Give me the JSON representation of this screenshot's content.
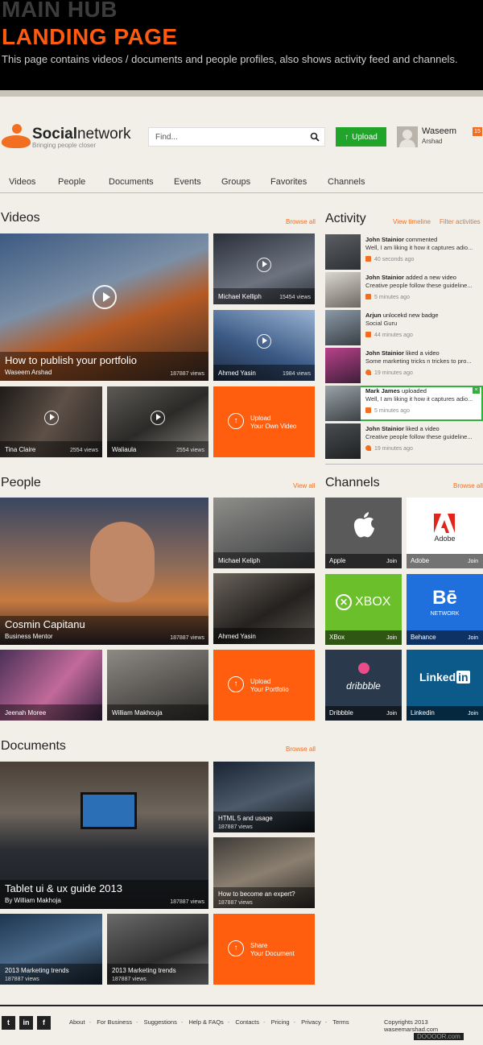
{
  "banner": {
    "title1": "MAIN HUB",
    "title2": "LANDING PAGE",
    "description": "This page contains videos / documents and people profiles, also shows activity feed and channels."
  },
  "header": {
    "brand_bold": "Social",
    "brand_rest": "network",
    "tagline": "Bringing people closer",
    "search_placeholder": "Find...",
    "upload_label": "Upload",
    "user_first": "Waseem",
    "user_last": "Arshad",
    "notification_count": "15"
  },
  "nav": [
    "Videos",
    "People",
    "Documents",
    "Events",
    "Groups",
    "Favorites",
    "Channels"
  ],
  "videos": {
    "title": "Videos",
    "link": "Browse all",
    "featured": {
      "title": "How to publish your portfolio",
      "author": "Waseem Arshad",
      "views": "187887 views"
    },
    "side": [
      {
        "name": "Michael Kelliph",
        "views": "15454 views"
      },
      {
        "name": "Ahmed Yasin",
        "views": "1984 views"
      }
    ],
    "bottom": [
      {
        "name": "Tina Claire",
        "views": "2554 views"
      },
      {
        "name": "Waliaula",
        "views": "2554 views"
      }
    ],
    "cta1": "Upload",
    "cta2": "Your Own Video"
  },
  "activity": {
    "title": "Activity",
    "link1": "View timeline",
    "link2": "Filter activities",
    "items": [
      {
        "name": "John Stainior",
        "action": "commented",
        "text": "Well, I am liking it how it captures adio...",
        "time": "40 seconds ago"
      },
      {
        "name": "John Stainior",
        "action": "added a new video",
        "text": "Creative people follow these guideline...",
        "time": "5 minutes ago"
      },
      {
        "name": "Arjun",
        "action": "unlocekd new badge",
        "text": "Social Guru",
        "time": "44 minutes ago"
      },
      {
        "name": "John Stainior",
        "action": "liked a video",
        "text": "Some marketing tricks n trickes to pro...",
        "time": "19 minutes ago"
      },
      {
        "name": "Mark James",
        "action": "uploaded",
        "text": "Well, I am liking it how it captures adio...",
        "time": "5 minutes ago"
      },
      {
        "name": "John Stainior",
        "action": "liked a video",
        "text": "Creative people follow these guideline...",
        "time": "19 minutes ago"
      }
    ]
  },
  "people": {
    "title": "People",
    "link": "View all",
    "featured": {
      "name": "Cosmin Capitanu",
      "role": "Business Mentor",
      "views": "187887 views"
    },
    "side": [
      "Michael Keliph",
      "Ahmed Yasin"
    ],
    "bottom": [
      "Jeenah Moree",
      "William Makhouja"
    ],
    "cta1": "Upload",
    "cta2": "Your Portfolio"
  },
  "channels": {
    "title": "Channels",
    "link": "Browse all",
    "join": "Join",
    "items": [
      {
        "name": "Apple",
        "color": "#5a5a5a",
        "logo": ""
      },
      {
        "name": "Adobe",
        "color": "#ffffff",
        "logo": "Adobe"
      },
      {
        "name": "XBox",
        "color": "#6bbf2a",
        "logo": "XBOX"
      },
      {
        "name": "Behance",
        "color": "#1f6fdc",
        "logo": "Bē",
        "logo_sub": "NETWORK"
      },
      {
        "name": "Dribbble",
        "color": "#2a3a4c",
        "logo": "dribbble"
      },
      {
        "name": "Linkedin",
        "color": "#0c5a8a",
        "logo": "Linked",
        "logo_box": "in"
      }
    ]
  },
  "documents": {
    "title": "Documents",
    "link": "Browse all",
    "featured": {
      "title": "Tablet ui & ux guide 2013",
      "author": "By William Makhoja",
      "views": "187887 views"
    },
    "side": [
      {
        "title": "HTML 5 and usage",
        "views": "187887 views"
      },
      {
        "title": "How to become an expert?",
        "views": "187887 views"
      }
    ],
    "bottom": [
      {
        "title": "2013 Marketing trends",
        "views": "187887 views"
      },
      {
        "title": "2013 Marketing trends",
        "views": "187887 views"
      }
    ],
    "cta1": "Share",
    "cta2": "Your Document"
  },
  "footer": {
    "links": [
      "About",
      "For Business",
      "Suggestions",
      "Help & FAQs",
      "Contacts",
      "Pricing",
      "Privacy",
      "Terms"
    ],
    "copyright": "Copyrights 2013 waseemarshad.com",
    "watermark": "DOOOOR.com"
  },
  "colors": {
    "accent": "#ff5e0e",
    "green": "#20a52a",
    "background": "#f2efe8"
  }
}
